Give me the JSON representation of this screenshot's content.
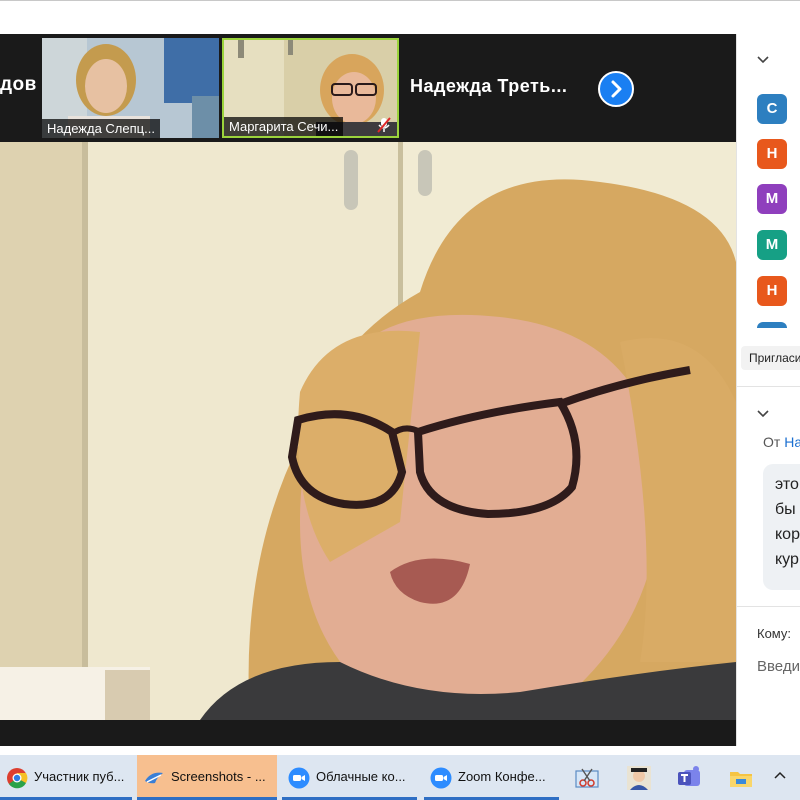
{
  "main": {
    "participant_strip": [
      {
        "name": "Надежда Слепц..."
      },
      {
        "name": "Маргарита Сечи...",
        "muted": true
      }
    ],
    "partial_left_name": "дов",
    "name_only_tile": "Надежда  Треть...",
    "next_icon": "chevron-right-icon",
    "active_speaker_color": "#9bd33c"
  },
  "participants_panel": {
    "avatars": [
      {
        "letter": "С",
        "color": "#2d7fc0"
      },
      {
        "letter": "Н",
        "color": "#e8581c"
      },
      {
        "letter": "М",
        "color": "#8f3fbd"
      },
      {
        "letter": "М",
        "color": "#16a085"
      },
      {
        "letter": "Н",
        "color": "#e8581c"
      }
    ],
    "invite_label": "Приглаcи"
  },
  "chat": {
    "from_prefix": "От",
    "sender": "На",
    "message_lines": [
      "это",
      "бы",
      "кор",
      "кур"
    ],
    "to_label": "Кому:",
    "input_placeholder": "Введи"
  },
  "taskbar": {
    "items": [
      {
        "label": "Участник пуб...",
        "icon": "chrome-icon",
        "active": true
      },
      {
        "label": "Screenshots - ...",
        "icon": "screenshots-app-icon",
        "active": true,
        "highlight": true
      },
      {
        "label": "Облачные ко...",
        "icon": "zoom-icon",
        "active": true
      },
      {
        "label": "Zoom Конфе...",
        "icon": "zoom-icon",
        "active": true
      }
    ],
    "tray": [
      "snipping-tool-icon",
      "teacher-app-icon",
      "teams-icon",
      "file-explorer-icon"
    ],
    "overflow_icon": "caret-up-icon"
  }
}
